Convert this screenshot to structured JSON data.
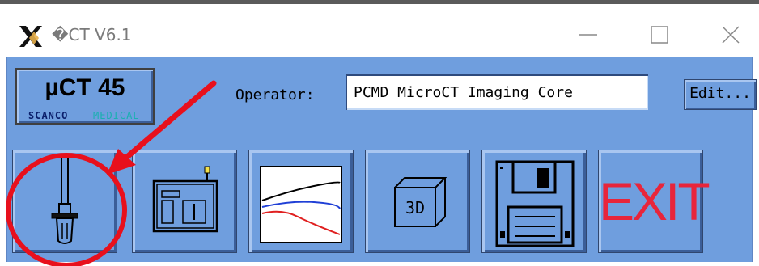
{
  "window": {
    "title": "\u0000CT V6.1",
    "title_display": "�CT V6.1",
    "app_icon": "x-logo-icon",
    "controls": {
      "minimize": "minimize-icon",
      "maximize": "maximize-icon",
      "close": "close-icon"
    }
  },
  "logo": {
    "title": "µCT 45",
    "subtitle_left": "SCANCO",
    "subtitle_right": "MEDICAL"
  },
  "operator": {
    "label": "Operator:",
    "value": "PCMD MicroCT Imaging Core"
  },
  "edit_button": {
    "label": "Edit..."
  },
  "toolbar": {
    "buttons": [
      {
        "name": "sample-holder-button",
        "icon": "sample-holder-icon"
      },
      {
        "name": "scanner-button",
        "icon": "scanner-icon"
      },
      {
        "name": "evaluation-graph-button",
        "icon": "graph-icon"
      },
      {
        "name": "3d-button",
        "icon": "3d-cube-icon",
        "label": "3D"
      },
      {
        "name": "save-button",
        "icon": "floppy-disk-icon"
      },
      {
        "name": "exit-button",
        "label": "EXIT"
      }
    ]
  },
  "colors": {
    "panel": "#6f9ede",
    "exit_text": "#e8253b",
    "annotation": "#e8101c",
    "logo_scanco": "#0b1f6b",
    "logo_medical": "#1ab0b0"
  }
}
